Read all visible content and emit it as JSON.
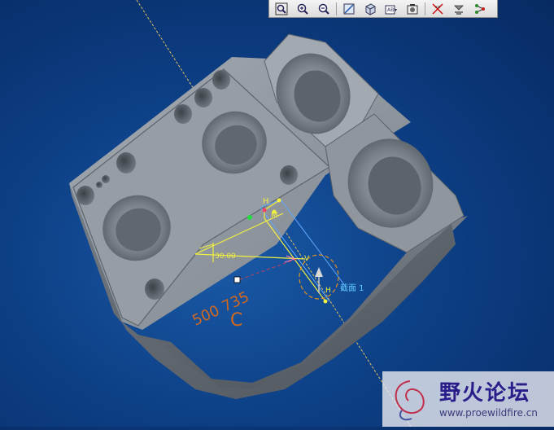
{
  "toolbar": {
    "icons": [
      "zoom-window-icon",
      "zoom-in-icon",
      "zoom-out-icon",
      "refit-icon",
      "orient-icon",
      "saved-views-icon",
      "layers-icon",
      "datum-display-icon",
      "annotation-display-icon",
      "datum-tree-icon"
    ]
  },
  "model": {
    "dimension_label": "30.00",
    "label_h_top": "H",
    "label_m": "M",
    "label_v": "V",
    "label_h_bottom": "H",
    "section_label": "截面 1",
    "engraving_line1": "500  735",
    "engraving_line2": "C"
  },
  "watermark": {
    "title": "野火论坛",
    "url": "www.proewildfire.cn"
  },
  "colors": {
    "background": "#0d3f85",
    "part": "#8c939b",
    "dimension": "#f0f040",
    "engraving": "#d06820",
    "datum_axis": "#e0c060",
    "sketch_blue": "#60a8ff"
  }
}
